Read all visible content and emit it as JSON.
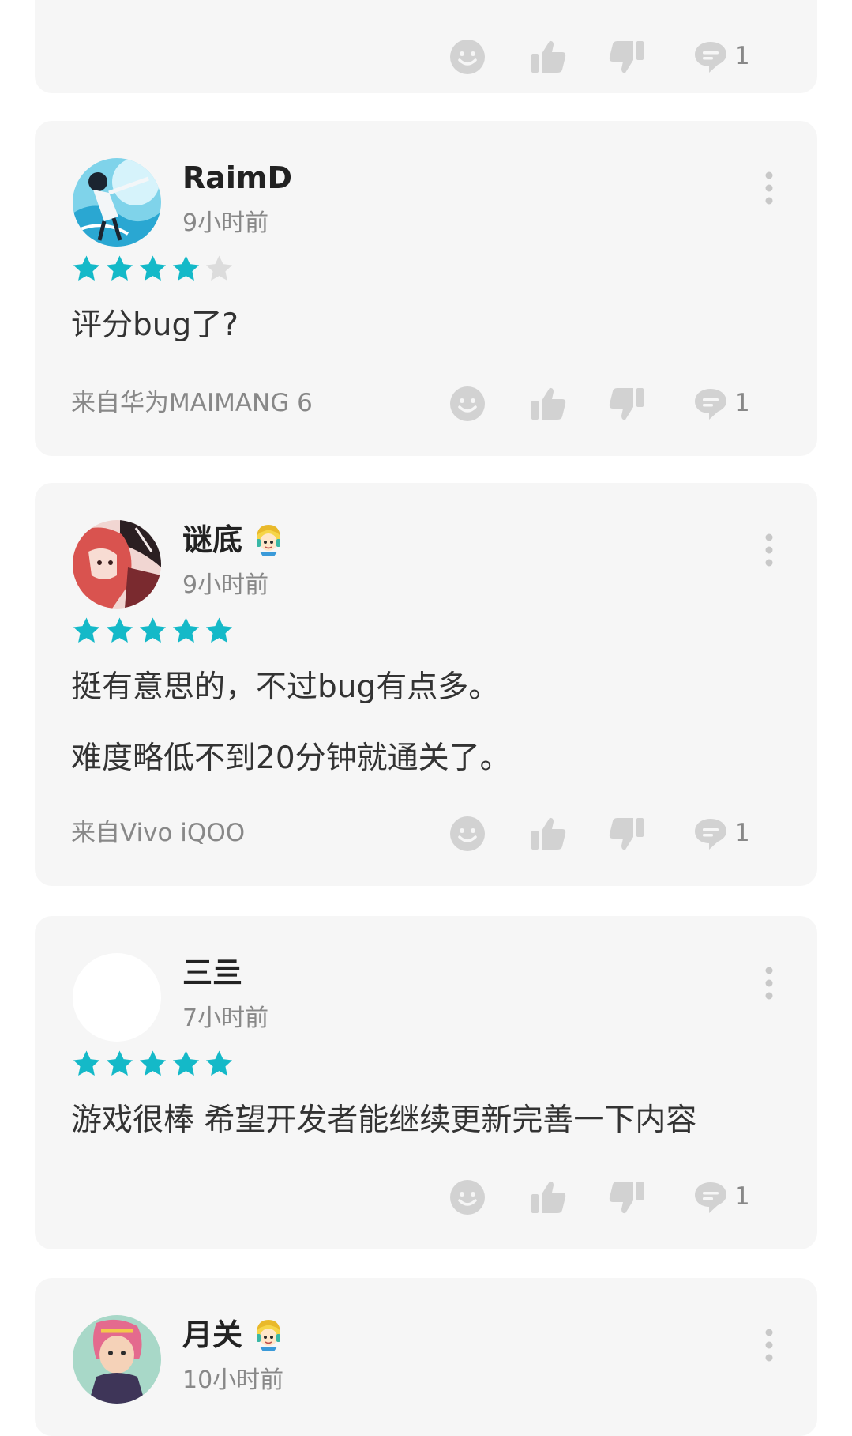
{
  "colors": {
    "card_bg": "#f6f6f6",
    "star_on": "#14b9c8",
    "star_off": "#dcdcdc",
    "icon": "#d2d2d2",
    "muted_text": "#888888"
  },
  "reviews": [
    {
      "comment_count": "1"
    },
    {
      "username": "RaimD",
      "time": "9小时前",
      "rating": 4,
      "content": [
        "评分bug了?"
      ],
      "device": "来自华为MAIMANG 6",
      "comment_count": "1"
    },
    {
      "username": "谜底",
      "time": "9小时前",
      "rating": 5,
      "content": [
        "挺有意思的，不过bug有点多。",
        "难度略低不到20分钟就通关了。"
      ],
      "device": "来自Vivo iQOO",
      "comment_count": "1"
    },
    {
      "username": "三亖",
      "time": "7小时前",
      "rating": 5,
      "content": [
        "游戏很棒 希望开发者能继续更新完善一下内容"
      ],
      "device": "",
      "comment_count": "1"
    },
    {
      "username": "月关",
      "time": "10小时前"
    }
  ]
}
